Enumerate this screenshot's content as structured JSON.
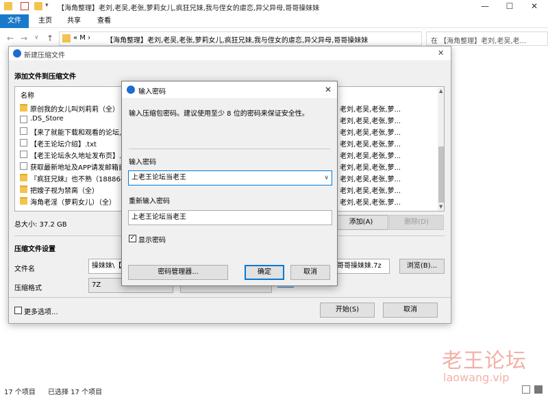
{
  "explorer": {
    "title": "【海角整理】老刘,老吴,老张,萝莉女儿,疯狂兄妹,我与侄女的虐恋,异父异母,哥哥操妹妹",
    "window_controls": {
      "minimize": "—",
      "maximize": "☐",
      "close": "✕"
    },
    "tabs": [
      "文件",
      "主页",
      "共享",
      "查看"
    ],
    "nav": {
      "back": "←",
      "forward": "→",
      "dropdown": "∨",
      "up": "↑"
    },
    "address": {
      "prefix": "«  M  ›",
      "path": "【海角整理】老刘,老吴,老张,萝莉女儿,疯狂兄妹,我与侄女的虐恋,异父异母,哥哥操妹妹"
    },
    "search_placeholder": "在 【海角整理】老刘,老吴,老...",
    "status": {
      "count": "17 个项目",
      "selected": "已选择 17 个项目"
    }
  },
  "watermark": {
    "line1": "老王论坛",
    "line2": "laowang.vip"
  },
  "zip_dialog": {
    "title": "新建压缩文件",
    "add_section": "添加文件到压缩文件",
    "column_name": "名称",
    "files": [
      {
        "name": "原创我的女儿叫刘莉莉（全）",
        "icon": "folder-icon",
        "right": "老刘,老吴,老张,萝..."
      },
      {
        "name": ".DS_Store",
        "icon": "file-icon",
        "right": "老刘,老吴,老张,萝..."
      },
      {
        "name": "【来了就能下载和观看的论坛,",
        "icon": "file-icon",
        "right": "老刘,老吴,老张,萝..."
      },
      {
        "name": "【老王论坛介绍】.txt",
        "icon": "file-icon",
        "right": "老刘,老吴,老张,萝..."
      },
      {
        "name": "【老王论坛永久地址发布页】.tx",
        "icon": "file-icon",
        "right": "老刘,老吴,老张,萝..."
      },
      {
        "name": "获取最新地址及APP请发邮箱自",
        "icon": "file-icon",
        "right": "老刘,老吴,老张,萝..."
      },
      {
        "name": "『疯狂兄妹』也不熟（188864",
        "icon": "folder-icon",
        "right": "老刘,老吴,老张,萝..."
      },
      {
        "name": "把嫂子视为禁脔（全）",
        "icon": "folder-icon",
        "right": "老刘,老吴,老张,萝..."
      },
      {
        "name": "海角老淫（萝莉女儿）（全）",
        "icon": "folder-icon",
        "right": "老刘,老吴,老张,萝..."
      }
    ],
    "total_size": "总大小: 37.2 GB",
    "add_button": "添加(A)",
    "delete_button": "删除(D)",
    "settings_section": "压缩文件设置",
    "filename_label": "文件名",
    "filename_value": "操妹妹\\【",
    "filename_value_right": "哥哥操妹妹.7z",
    "browse_button": "浏览(B)...",
    "format_label": "压缩格式",
    "format_value": "7Z",
    "more_options": "更多选项...",
    "start_button": "开始(S)",
    "cancel_button": "取消"
  },
  "password_dialog": {
    "title": "输入密码",
    "description": "输入压缩包密码。建议使用至少 8 位的密码来保证安全性。",
    "password_label": "输入密码",
    "password_value": "上老王论坛当老王",
    "confirm_label": "重新输入密码",
    "confirm_value": "上老王论坛当老王",
    "show_password": "显示密码",
    "show_password_checked": true,
    "manager_button": "密码管理器...",
    "ok_button": "确定",
    "cancel_button": "取消"
  }
}
